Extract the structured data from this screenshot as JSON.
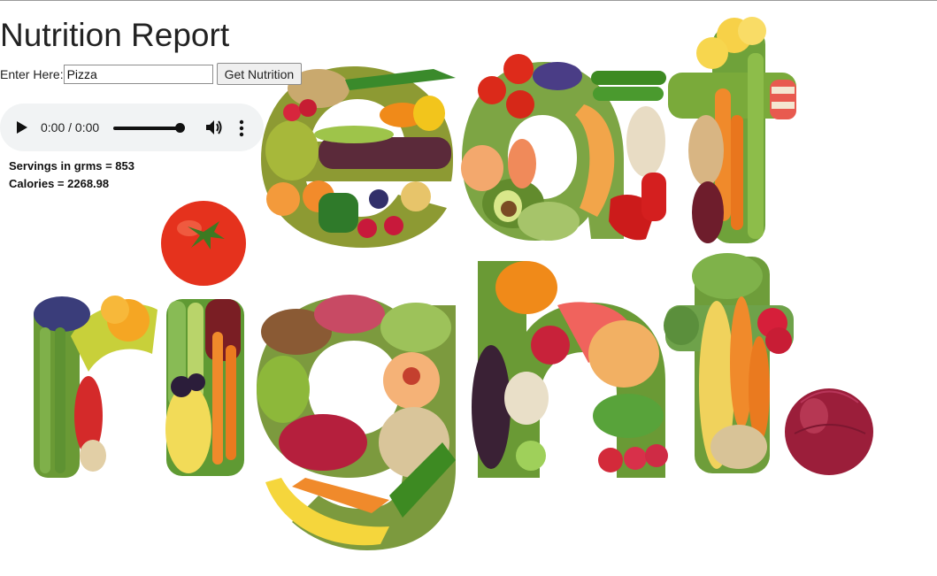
{
  "page": {
    "title": "Nutrition Report",
    "background_image": "eat-right-fruit-vegetable-letters"
  },
  "search": {
    "label": "Enter Here:",
    "value": "Pizza",
    "button_label": "Get Nutrition"
  },
  "audio": {
    "time_display": "0:00 / 0:00",
    "play_icon": "play-icon",
    "volume_icon": "volume-icon",
    "menu_icon": "more-vert-icon"
  },
  "results": {
    "servings_label": "Servings in grms = ",
    "servings_value": "853",
    "calories_label": "Calories = ",
    "calories_value": "2268.98"
  }
}
